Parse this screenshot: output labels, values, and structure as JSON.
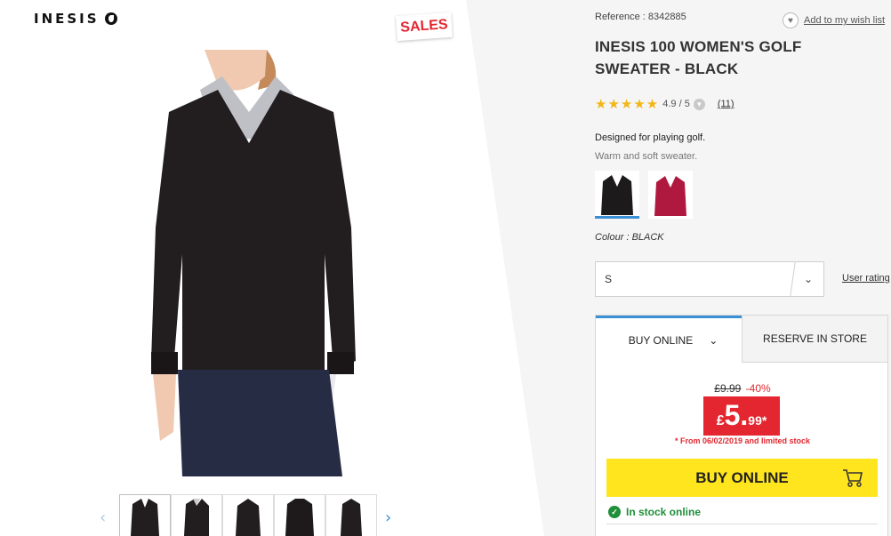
{
  "brand": {
    "logo_text": "INESIS"
  },
  "badge": {
    "sales": "SALES"
  },
  "gallery": {
    "main_image": "woman-in-black-v-neck-sweater-photo",
    "thumbnails": [
      "thumb-front",
      "thumb-side",
      "thumb-back",
      "thumb-detail",
      "thumb-side-2"
    ],
    "prev_arrow": "‹",
    "next_arrow": "›"
  },
  "product": {
    "reference": "Reference : 8342885",
    "wishlist_label": "Add to my wish list",
    "title": "INESIS 100 WOMEN'S GOLF SWEATER - BLACK",
    "stars": "★★★★★",
    "rating": "4.9 / 5",
    "review_count": "(11)",
    "description_line1": "Designed for playing golf.",
    "description_line2": "Warm and soft sweater.",
    "colour_label": "Colour : BLACK",
    "colours": [
      "#1c1a1b",
      "#b0193f"
    ]
  },
  "size": {
    "selected": "S",
    "user_rating_link": "User rating"
  },
  "buy": {
    "tab_buy_online": "BUY ONLINE",
    "tab_reserve": "RESERVE IN STORE",
    "old_price": "£9.99",
    "discount": "-40%",
    "price_currency": "£",
    "price_int": "5.",
    "price_dec": "99*",
    "from_note": "* From 06/02/2019 and limited stock",
    "buy_button": "BUY ONLINE",
    "stock_status": "In stock online"
  },
  "colors": {
    "accent_blue": "#3b8fd4",
    "sale_red": "#e3262f",
    "buy_yellow": "#ffe51e",
    "stock_green": "#1f8f3a"
  }
}
